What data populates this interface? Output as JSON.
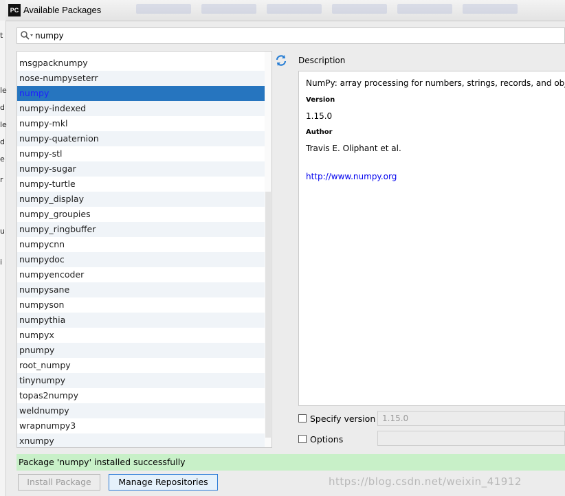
{
  "window": {
    "title": "Available Packages",
    "app_icon": "PC"
  },
  "search": {
    "value": "numpy",
    "icon": "search-icon"
  },
  "list": {
    "partial_top": "msgpack-numpy",
    "items": [
      "msgpacknumpy",
      "nose-numpyseterr",
      "numpy",
      "numpy-indexed",
      "numpy-mkl",
      "numpy-quaternion",
      "numpy-stl",
      "numpy-sugar",
      "numpy-turtle",
      "numpy_display",
      "numpy_groupies",
      "numpy_ringbuffer",
      "numpycnn",
      "numpydoc",
      "numpyencoder",
      "numpysane",
      "numpyson",
      "numpythia",
      "numpyx",
      "pnumpy",
      "root_numpy",
      "tinynumpy",
      "topas2numpy",
      "weldnumpy",
      "wrapnumpy3",
      "xnumpy"
    ],
    "selected": "numpy"
  },
  "description": {
    "label": "Description",
    "summary": "NumPy: array processing for numbers, strings, records, and objects.",
    "version_heading": "Version",
    "version": "1.15.0",
    "author_heading": "Author",
    "author": "Travis E. Oliphant et al.",
    "url": "http://www.numpy.org"
  },
  "options": {
    "specify_version_label": "Specify version",
    "specify_version_value": "1.15.0",
    "options_label": "Options",
    "options_value": ""
  },
  "status": "Package 'numpy' installed successfully",
  "buttons": {
    "install": "Install Package",
    "manage": "Manage Repositories"
  },
  "watermark": "https://blog.csdn.net/weixin_41912",
  "colors": {
    "selection": "#2675bf",
    "status_bg": "#c8f0c8",
    "link": "#0000ee"
  }
}
